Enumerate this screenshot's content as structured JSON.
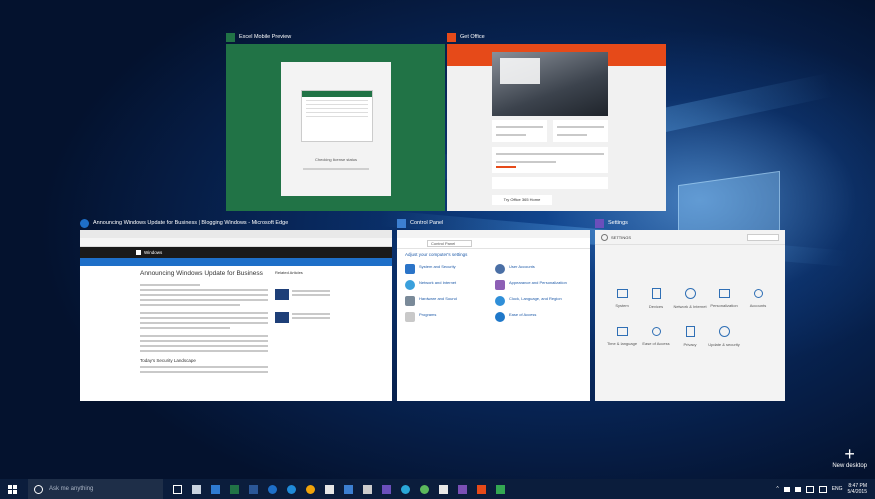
{
  "windows": {
    "excel": {
      "title": "Excel Mobile Preview",
      "loading_text": "Checking license status"
    },
    "office": {
      "title": "Get Office",
      "cta": "Try Office 365 Home"
    },
    "edge": {
      "title": "Announcing Windows Update for Business | Blogging Windows - Microsoft Edge",
      "brand": "Windows",
      "article_title": "Announcing Windows Update for Business",
      "sidebar_heading": "Related Articles",
      "subheading": "Today's Security Landscape"
    },
    "control_panel": {
      "title": "Control Panel",
      "address": "Control Panel",
      "heading": "Adjust your computer's settings",
      "items": [
        "System and Security",
        "Network and Internet",
        "Hardware and Sound",
        "Programs",
        "User Accounts",
        "Appearance and Personalization",
        "Clock, Language, and Region",
        "Ease of Access"
      ]
    },
    "settings": {
      "title": "Settings",
      "header": "SETTINGS",
      "items": [
        "System",
        "Devices",
        "Network & Internet",
        "Personalization",
        "Accounts",
        "Time & language",
        "Ease of Access",
        "Privacy",
        "Update & security"
      ]
    }
  },
  "new_desktop": {
    "label": "New desktop"
  },
  "taskbar": {
    "search_placeholder": "Ask me anything",
    "tray_time": "8:47 PM",
    "tray_date": "5/4/2015",
    "tray_lang": "ENG"
  },
  "colors": {
    "excel_green": "#217346",
    "office_red": "#e64a19",
    "edge_blue": "#1e6fc8",
    "cp_blue": "#3c7fd1",
    "settings_purple": "#6b4fbb"
  }
}
